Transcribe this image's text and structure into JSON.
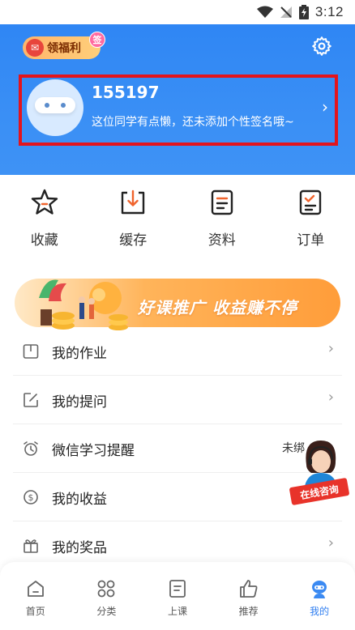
{
  "status_bar": {
    "time": "3:12",
    "icons": [
      "wifi-icon",
      "signal-off-icon",
      "battery-charging-icon"
    ]
  },
  "header": {
    "welfare_label": "领福利",
    "welfare_badge": "签",
    "username": "155197",
    "signature": "这位同学有点懒，还未添加个性签名哦~"
  },
  "quick_actions": [
    {
      "label": "收藏",
      "icon": "star-icon"
    },
    {
      "label": "缓存",
      "icon": "download-icon"
    },
    {
      "label": "资料",
      "icon": "document-icon"
    },
    {
      "label": "订单",
      "icon": "order-icon"
    }
  ],
  "banner": {
    "text": "好课推广  收益赚不停"
  },
  "menu": [
    {
      "label": "我的作业",
      "icon": "homework-icon",
      "right": ""
    },
    {
      "label": "我的提问",
      "icon": "edit-icon",
      "right": ""
    },
    {
      "label": "微信学习提醒",
      "icon": "alarm-icon",
      "right": "未绑"
    },
    {
      "label": "我的收益",
      "icon": "money-icon",
      "right": ""
    },
    {
      "label": "我的奖品",
      "icon": "gift-icon",
      "right": ""
    }
  ],
  "consult": {
    "label": "在线咨询"
  },
  "tabs": [
    {
      "label": "首页",
      "icon": "home-icon"
    },
    {
      "label": "分类",
      "icon": "category-icon"
    },
    {
      "label": "上课",
      "icon": "class-icon"
    },
    {
      "label": "推荐",
      "icon": "thumbs-up-icon"
    },
    {
      "label": "我的",
      "icon": "profile-icon"
    }
  ],
  "colors": {
    "accent": "#2f86f4",
    "highlight_box": "#e3141c"
  }
}
